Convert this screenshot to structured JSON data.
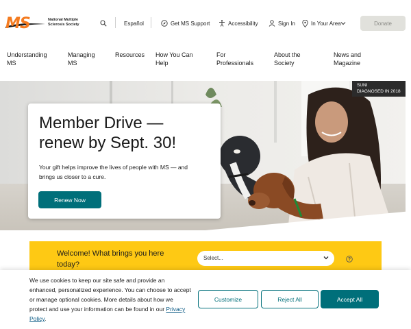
{
  "header": {
    "logo_mark": "MS",
    "logo_text": "National Multiple Sclerosis Society",
    "utility": {
      "espanol": "Español",
      "support": "Get MS Support",
      "accessibility": "Accessibility",
      "signin": "Sign In",
      "area": "In Your Area"
    },
    "donate": "Donate"
  },
  "nav": {
    "items": [
      "Understanding MS",
      "Managing MS",
      "Resources",
      "How You Can Help",
      "For Professionals",
      "About the Society",
      "News and Magazine"
    ]
  },
  "hero": {
    "caption_name": "SUNI",
    "caption_detail": "DIAGNOSED IN 2018",
    "title": "Member Drive — renew by Sept. 30!",
    "body": "Your gift helps improve the lives of people with MS — and brings us closer to a cure.",
    "button": "Renew Now"
  },
  "welcome": {
    "prompt": "Welcome! What brings you here today?",
    "select_value": "Select..."
  },
  "cookie": {
    "text": "We use cookies to keep our site safe and provide an enhanced, personalized experience. You can choose to accept or manage optional cookies. More details about how we protect and use your information can be found in our",
    "link": "Privacy Policy",
    "period": ".",
    "customize": "Customize",
    "reject": "Reject All",
    "accept": "Accept All"
  },
  "colors": {
    "brand_orange": "#f47b20",
    "teal": "#006f7a",
    "yellow": "#fec914",
    "donate_bg": "#e1e1dc"
  },
  "icons": [
    "search-icon",
    "compass-icon",
    "accessibility-icon",
    "user-icon",
    "location-pin-icon",
    "chevron-down-icon",
    "help-circle-icon"
  ]
}
